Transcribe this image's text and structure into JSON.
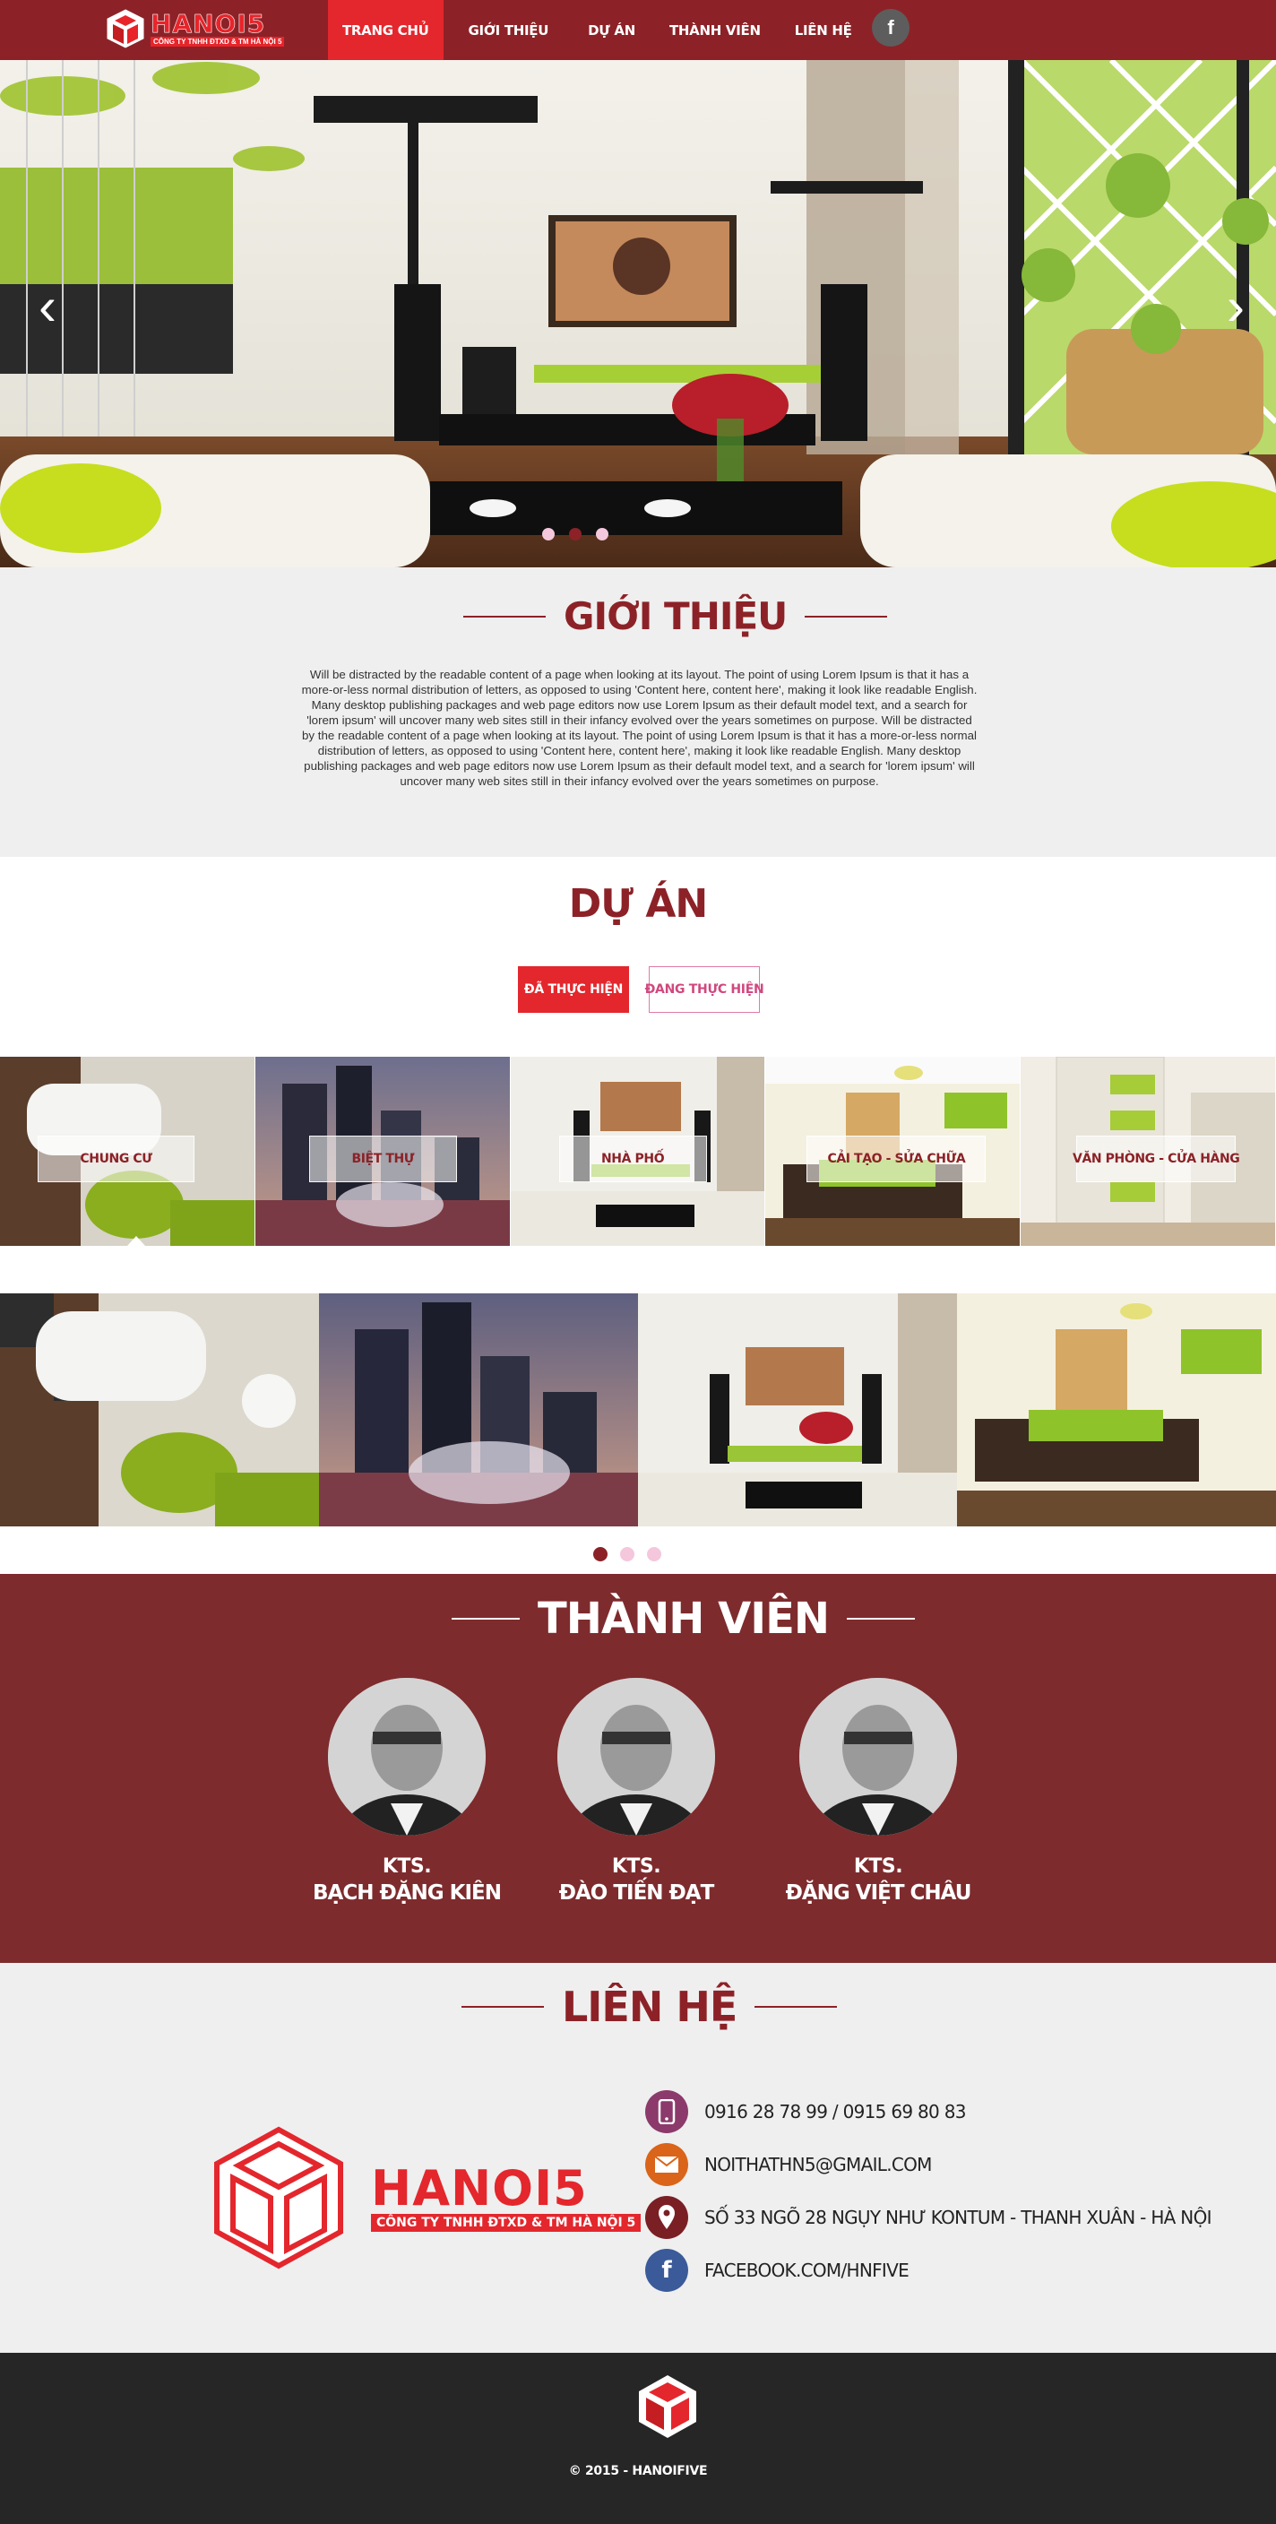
{
  "brand": {
    "name": "HANOI5",
    "tagline": "CÔNG TY TNHH ĐTXD & TM HÀ NỘI 5"
  },
  "nav": {
    "items": [
      {
        "label": "TRANG CHỦ",
        "active": true
      },
      {
        "label": "GIỚI THIỆU",
        "active": false
      },
      {
        "label": "DỰ ÁN",
        "active": false
      },
      {
        "label": "THÀNH VIÊN",
        "active": false
      },
      {
        "label": "LIÊN HỆ",
        "active": false
      }
    ],
    "social_icon": "facebook-icon",
    "social_glyph": "f"
  },
  "hero": {
    "arrow_left": "‹",
    "arrow_right": "›",
    "slide_count": 3,
    "active_slide": 2
  },
  "about": {
    "title": "GIỚI THIỆU",
    "body": "Will be distracted by the readable content of a page when looking at its layout. The point of using Lorem Ipsum is that it has a more-or-less normal distribution of letters, as opposed to using 'Content here, content here', making it look like readable English. Many desktop publishing packages and web page editors now use Lorem Ipsum as their default model text, and a search for 'lorem ipsum' will uncover many web sites still in their infancy evolved over the years sometimes on purpose. Will be distracted by the readable content of a page when looking at its layout. The point of using Lorem Ipsum is that it has a more-or-less normal distribution of letters, as opposed to using 'Content here, content here', making it look like readable English. Many desktop publishing packages and web page editors now use Lorem Ipsum as their default model text, and a search for 'lorem ipsum' will uncover many web sites still in their infancy evolved over the years sometimes on purpose."
  },
  "projects": {
    "title": "DỰ ÁN",
    "tabs": [
      {
        "label": "ĐÃ THỰC HIỆN",
        "active": true
      },
      {
        "label": "ĐANG THỰC HIỆN",
        "active": false
      }
    ],
    "categories": [
      {
        "label": "CHUNG CƯ",
        "selected": true
      },
      {
        "label": "BIỆT THỰ",
        "selected": false
      },
      {
        "label": "NHÀ PHỐ",
        "selected": false
      },
      {
        "label": "CẢI TẠO - SỬA CHỮA",
        "selected": false
      },
      {
        "label": "VĂN PHÒNG - CỬA HÀNG",
        "selected": false
      }
    ],
    "gallery_dot_count": 3,
    "gallery_active_dot": 1
  },
  "members": {
    "title": "THÀNH VIÊN",
    "list": [
      {
        "role": "KTS.",
        "name": "BẠCH ĐẶNG KIÊN"
      },
      {
        "role": "KTS.",
        "name": "ĐÀO TIẾN ĐẠT"
      },
      {
        "role": "KTS.",
        "name": "ĐẶNG VIỆT CHÂU"
      }
    ]
  },
  "contact": {
    "title": "LIÊN HỆ",
    "phone": "0916 28 78 99  /  0915 69 80 83",
    "email": "NOITHATHN5@GMAIL.COM",
    "address": "SỐ 33 NGÕ 28 NGỤY NHƯ KONTUM - THANH XUÂN - HÀ NỘI",
    "facebook": "FACEBOOK.COM/HNFIVE",
    "icons": [
      "phone-icon",
      "mail-icon",
      "location-icon",
      "facebook-icon"
    ],
    "icon_colors": [
      "#8b3a6b",
      "#d9641a",
      "#7a1f24",
      "#3b5a9a"
    ]
  },
  "footer": {
    "copyright": "© 2015 -  HANOIFIVE"
  },
  "colors": {
    "primary": "#8c2227",
    "accent": "#e3272d",
    "members_bg": "#7e2b2d",
    "footer_bg": "#262626"
  }
}
